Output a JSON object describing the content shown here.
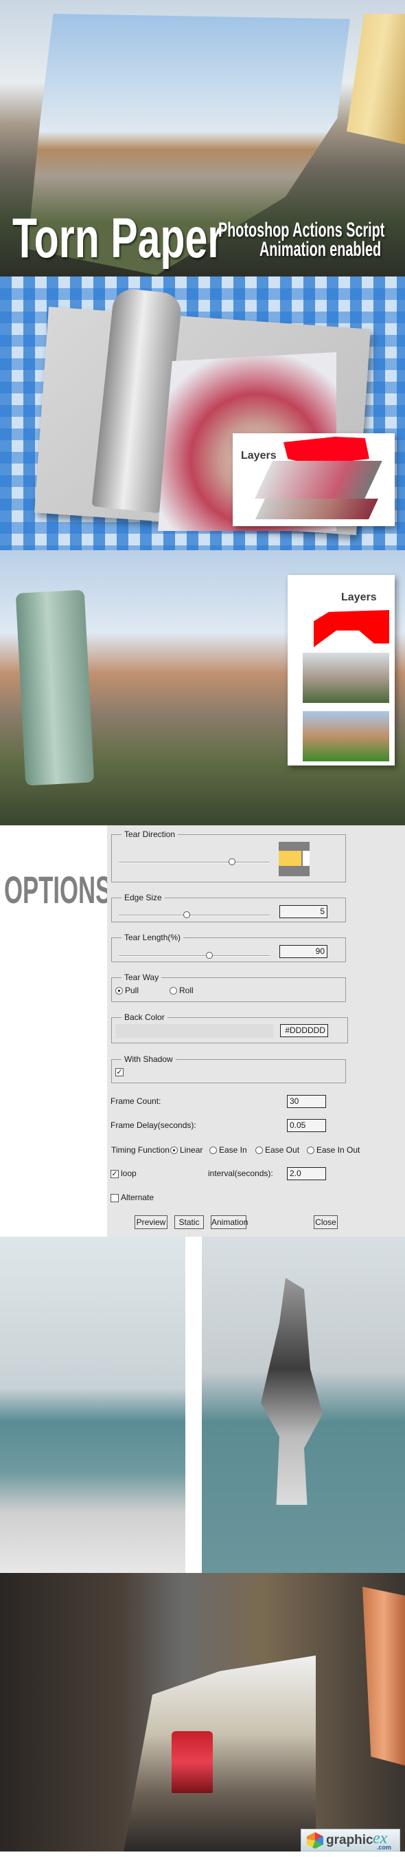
{
  "hero": {
    "title": "Torn Paper",
    "subtitle_line1": "Photoshop Actions Script",
    "subtitle_line2": "Animation enabled"
  },
  "layers_panels": [
    {
      "label": "Layers"
    },
    {
      "label": "Layers"
    }
  ],
  "options": {
    "heading": "OPTIONS",
    "tear_direction": {
      "label": "Tear Direction",
      "slider_percent": 75
    },
    "edge_size": {
      "label": "Edge Size",
      "value": "5",
      "slider_percent": 45
    },
    "tear_length": {
      "label": "Tear Length(%)",
      "value": "90",
      "slider_percent": 60
    },
    "tear_way": {
      "label": "Tear Way",
      "options": [
        "Pull",
        "Roll"
      ],
      "selected": "Pull"
    },
    "back_color": {
      "label": "Back Color",
      "value": "#DDDDDD",
      "swatch_color": "#DDDDDD"
    },
    "with_shadow": {
      "label": "With Shadow",
      "checked": true
    },
    "frame_count": {
      "label": "Frame Count:",
      "value": "30"
    },
    "frame_delay": {
      "label": "Frame Delay(seconds):",
      "value": "0.05"
    },
    "timing": {
      "label": "Timing Function",
      "options": [
        "Linear",
        "Ease In",
        "Ease Out",
        "Ease In Out"
      ],
      "selected": "Linear"
    },
    "loop": {
      "label": "loop",
      "checked": true
    },
    "interval": {
      "label": "interval(seconds):",
      "value": "2.0"
    },
    "alternate": {
      "label": "Alternate",
      "checked": false
    },
    "buttons": {
      "preview": "Preview",
      "static": "Static",
      "animation": "Animation",
      "close": "Close"
    }
  },
  "watermark": {
    "brand": "graphic",
    "brand_script": "ex",
    "tld": ".com"
  },
  "colors": {
    "options_heading": "#808080",
    "panel_bg": "#E6E6E6",
    "tear_preview_yellow": "#F9CF55",
    "layer_mask_red": "#FF0000"
  }
}
